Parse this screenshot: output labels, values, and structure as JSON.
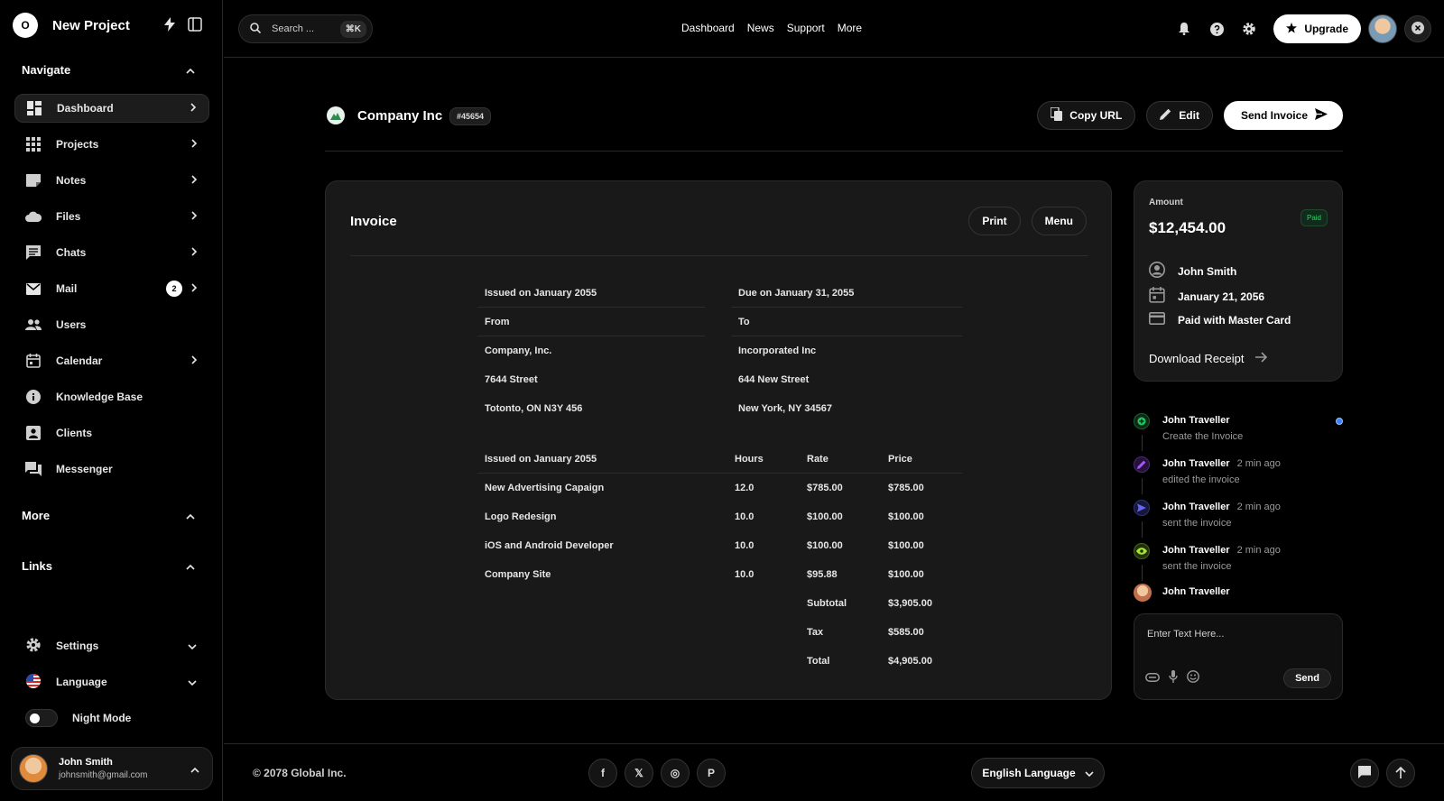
{
  "app": {
    "title": "New Project",
    "logo": "O"
  },
  "sidebar": {
    "navigate_label": "Navigate",
    "items": [
      {
        "label": "Dashboard",
        "icon": "dashboard-icon"
      },
      {
        "label": "Projects",
        "icon": "grid-icon"
      },
      {
        "label": "Notes",
        "icon": "note-icon"
      },
      {
        "label": "Files",
        "icon": "cloud-icon"
      },
      {
        "label": "Chats",
        "icon": "chat-icon"
      },
      {
        "label": "Mail",
        "icon": "mail-icon",
        "badge": "2"
      },
      {
        "label": "Users",
        "icon": "users-icon"
      },
      {
        "label": "Calendar",
        "icon": "calendar-icon"
      },
      {
        "label": "Knowledge Base",
        "icon": "info-icon"
      },
      {
        "label": "Clients",
        "icon": "contact-icon"
      },
      {
        "label": "Messenger",
        "icon": "forum-icon"
      }
    ],
    "more_label": "More",
    "links_label": "Links",
    "settings_label": "Settings",
    "language_label": "Language",
    "night_mode_label": "Night Mode",
    "user": {
      "name": "John Smith",
      "email": "johnsmith@gmail.com"
    }
  },
  "topbar": {
    "search_placeholder": "Search ...",
    "search_shortcut": "⌘K",
    "nav": [
      "Dashboard",
      "News",
      "Support",
      "More"
    ],
    "upgrade_label": "Upgrade"
  },
  "header": {
    "company": "Company Inc",
    "tag": "#45654",
    "copy_url": "Copy URL",
    "edit": "Edit",
    "send_invoice": "Send Invoice"
  },
  "invoice": {
    "title": "Invoice",
    "print": "Print",
    "menu": "Menu",
    "issued": "Issued on January 2055",
    "due": "Due on January 31, 2055",
    "from_label": "From",
    "to_label": "To",
    "from": [
      "Company, Inc.",
      "7644 Street",
      "Totonto, ON N3Y 456"
    ],
    "to": [
      "Incorporated Inc",
      "644 New Street",
      "New York, NY 34567"
    ],
    "columns": [
      "Issued on January 2055",
      "Hours",
      "Rate",
      "Price"
    ],
    "rows": [
      {
        "item": "New Advertising Capaign",
        "hours": "12.0",
        "rate": "$785.00",
        "price": "$785.00"
      },
      {
        "item": "Logo Redesign",
        "hours": "10.0",
        "rate": "$100.00",
        "price": "$100.00"
      },
      {
        "item": "iOS and Android Developer",
        "hours": "10.0",
        "rate": "$100.00",
        "price": "$100.00"
      },
      {
        "item": "Company Site",
        "hours": "10.0",
        "rate": "$95.88",
        "price": "$100.00"
      }
    ],
    "subtotal_label": "Subtotal",
    "subtotal": "$3,905.00",
    "tax_label": "Tax",
    "tax": "$585.00",
    "total_label": "Total",
    "total": "$4,905.00"
  },
  "amount": {
    "label": "Amount",
    "value": "$12,454.00",
    "status": "Paid",
    "name": "John Smith",
    "date": "January 21, 2056",
    "payment": "Paid with Master Card",
    "download": "Download Receipt"
  },
  "activity": [
    {
      "name": "John Traveller",
      "time": "",
      "desc": "Create the Invoice",
      "icon": "plus-icon",
      "color": "#22c55e"
    },
    {
      "name": "John Traveller",
      "time": "2 min ago",
      "desc": "edited the invoice",
      "icon": "pencil-icon",
      "color": "#a855f7"
    },
    {
      "name": "John Traveller",
      "time": "2 min ago",
      "desc": "sent the invoice",
      "icon": "send-icon",
      "color": "#6366f1"
    },
    {
      "name": "John Traveller",
      "time": "2 min ago",
      "desc": "sent the invoice",
      "icon": "eye-icon",
      "color": "#a3e635"
    },
    {
      "name": "John Traveller",
      "time": "",
      "desc": "",
      "icon": "avatar",
      "color": "#f0c8a0"
    }
  ],
  "composer": {
    "placeholder": "Enter Text Here...",
    "send": "Send"
  },
  "footer": {
    "copyright": "© 2078 Global Inc.",
    "socials": [
      "f",
      "𝕏",
      "◎",
      "P"
    ],
    "language": "English Language"
  }
}
